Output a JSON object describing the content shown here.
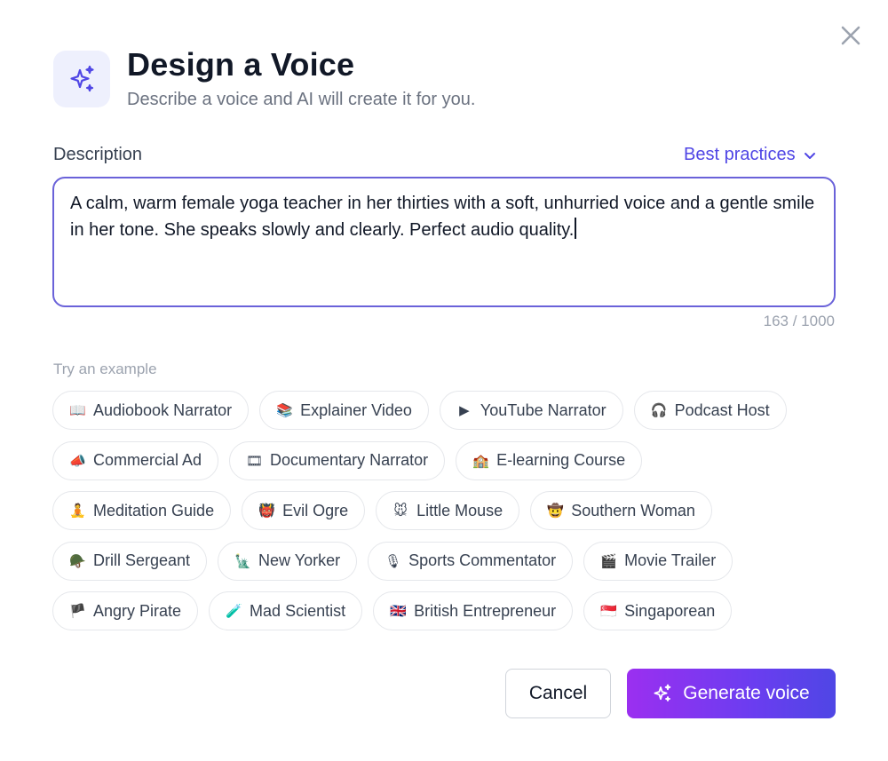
{
  "dialog": {
    "title": "Design a Voice",
    "subtitle": "Describe a voice and AI will create it for you.",
    "header_icon": "sparkles-icon",
    "close_icon": "close-icon"
  },
  "description": {
    "label": "Description",
    "best_practices_label": "Best practices",
    "value": "A calm, warm female yoga teacher in her thirties with a soft, unhurried voice and a gentle smile in her tone. She speaks slowly and clearly. Perfect audio quality.",
    "counter": "163 / 1000"
  },
  "examples": {
    "label": "Try an example",
    "rows": [
      [
        {
          "emoji": "📖",
          "label": "Audiobook Narrator"
        },
        {
          "emoji": "📚",
          "label": "Explainer Video"
        },
        {
          "emoji": "▶",
          "label": "YouTube Narrator"
        },
        {
          "emoji": "🎧",
          "label": "Podcast Host"
        }
      ],
      [
        {
          "emoji": "📣",
          "label": "Commercial Ad"
        },
        {
          "emoji": "🎞",
          "label": "Documentary Narrator"
        },
        {
          "emoji": "🏫",
          "label": "E-learning Course"
        }
      ],
      [
        {
          "emoji": "🧘",
          "label": "Meditation Guide"
        },
        {
          "emoji": "👹",
          "label": "Evil Ogre"
        },
        {
          "emoji": "🐭",
          "label": "Little Mouse"
        },
        {
          "emoji": "🤠",
          "label": "Southern Woman"
        }
      ],
      [
        {
          "emoji": "🪖",
          "label": "Drill Sergeant"
        },
        {
          "emoji": "🗽",
          "label": "New Yorker"
        },
        {
          "emoji": "🎙",
          "label": "Sports Commentator"
        },
        {
          "emoji": "🎬",
          "label": "Movie Trailer"
        }
      ],
      [
        {
          "emoji": "🏴",
          "label": "Angry Pirate"
        },
        {
          "emoji": "🧪",
          "label": "Mad Scientist"
        },
        {
          "emoji": "🇬🇧",
          "label": "British Entrepreneur"
        },
        {
          "emoji": "🇸🇬",
          "label": "Singaporean"
        }
      ]
    ]
  },
  "actions": {
    "cancel_label": "Cancel",
    "generate_label": "Generate voice"
  },
  "colors": {
    "accent": "#5046e5",
    "focus_border": "#6a62d9",
    "generate_gradient_start": "#9b2ff0",
    "generate_gradient_end": "#4f46e5"
  }
}
